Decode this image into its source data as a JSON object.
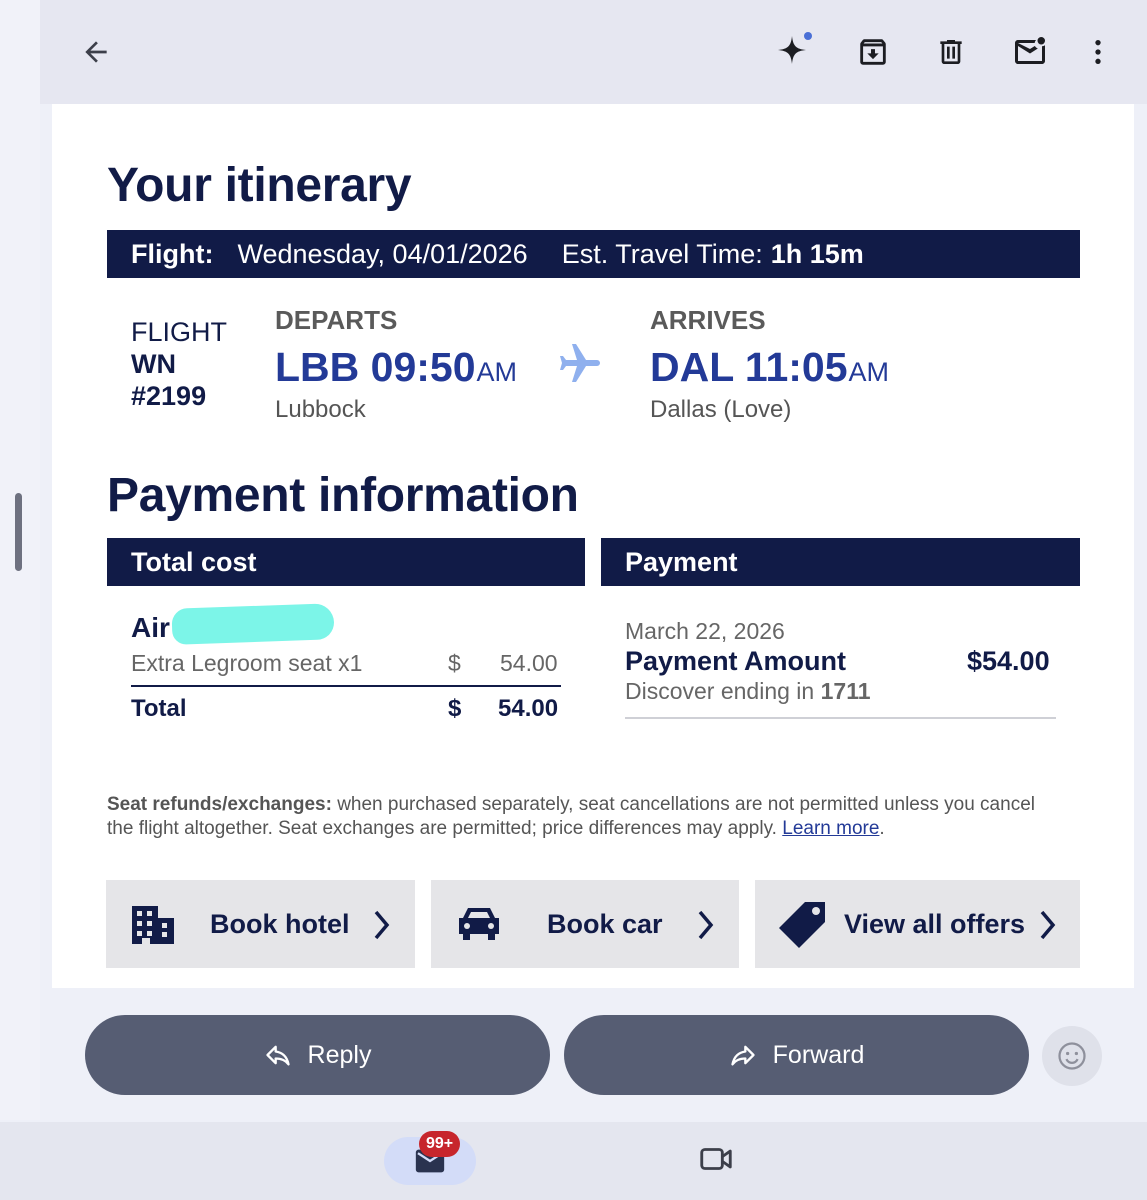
{
  "toolbar": {
    "back_icon": "arrow-left-icon",
    "gemini_icon": "sparkle-icon",
    "archive_icon": "archive-icon",
    "delete_icon": "trash-icon",
    "mark_unread_icon": "mark-unread-icon",
    "more_icon": "more-vert-icon"
  },
  "itinerary": {
    "heading": "Your itinerary",
    "flight_label": "Flight:",
    "flight_date": "Wednesday, 04/01/2026",
    "travel_time_label": "Est. Travel Time:",
    "travel_time": "1h 15m",
    "flight_word": "FLIGHT",
    "airline": "WN",
    "flight_number": "#2199",
    "departs_label": "DEPARTS",
    "departs_code_time": "LBB 09:50",
    "departs_ampm": "AM",
    "departs_city": "Lubbock",
    "arrives_label": "ARRIVES",
    "arrives_code_time": "DAL 11:05",
    "arrives_ampm": "AM",
    "arrives_city": "Dallas (Love)"
  },
  "payment": {
    "heading": "Payment information",
    "total_cost_header": "Total cost",
    "payment_header": "Payment",
    "air_label": "Air -",
    "item_desc": "Extra Legroom seat x1",
    "currency": "$",
    "item_amount": "54.00",
    "total_label": "Total",
    "total_amount": "54.00",
    "date": "March 22, 2026",
    "amount_label": "Payment Amount",
    "amount": "$54.00",
    "card_text": "Discover ending in",
    "card_last4": "1711"
  },
  "note": {
    "bold": "Seat refunds/exchanges:",
    "text": " when purchased separately, seat cancellations are not permitted unless you cancel the flight altogether. Seat exchanges are permitted; price differences may apply. ",
    "link": "Learn more",
    "end": "."
  },
  "promos": {
    "hotel": "Book hotel",
    "car": "Book car",
    "offers": "View all offers"
  },
  "actions": {
    "reply": "Reply",
    "forward": "Forward"
  },
  "bottom_nav": {
    "mail_badge": "99+"
  },
  "colors": {
    "navy": "#111b47",
    "blue": "#233a97",
    "button_gray": "#565d73",
    "badge_red": "#c7262c"
  }
}
